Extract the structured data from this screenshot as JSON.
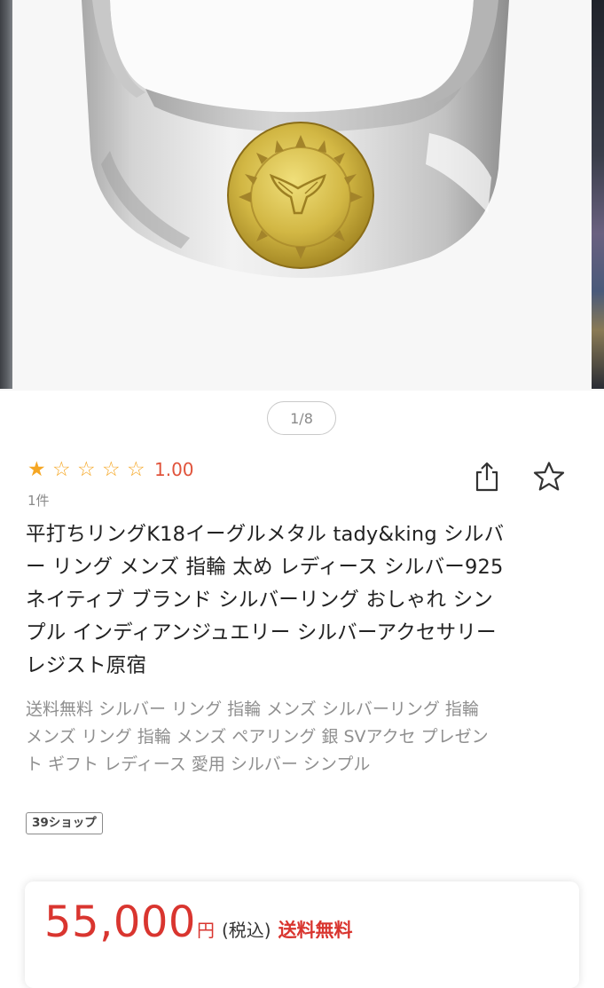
{
  "carousel": {
    "page_indicator": "1/8",
    "current_page": 1,
    "total_pages": 8
  },
  "rating": {
    "score": 1.0,
    "value_text": "1.00",
    "max_stars": 5,
    "star_color": "#f5a623",
    "review_count": "1件"
  },
  "actions": {
    "share_icon": "share-icon",
    "favorite_icon": "star-outline-icon"
  },
  "product": {
    "title_lines": [
      "平打ちリングK18イーグルメタル tady&king シルバ",
      "ー リング メンズ 指輪 太め レディース シルバー925",
      "ネイティブ ブランド シルバーリング おしゃれ シン",
      "プル インディアンジュエリー シルバーアクセサリー",
      "レジスト原宿"
    ],
    "subtitle_lines": [
      "送料無料 シルバー リング 指輪 メンズ シルバーリング 指輪",
      "メンズ リング 指輪 メンズ ペアリング 銀 SVアクセ プレゼン",
      "ト ギフト レディース 愛用 シルバー シンプル"
    ],
    "shop_badge": "39ショップ"
  },
  "price": {
    "amount": "55,000",
    "currency": "円",
    "tax_note": "(税込)",
    "shipping": "送料無料",
    "accent_color": "#d9352f"
  }
}
